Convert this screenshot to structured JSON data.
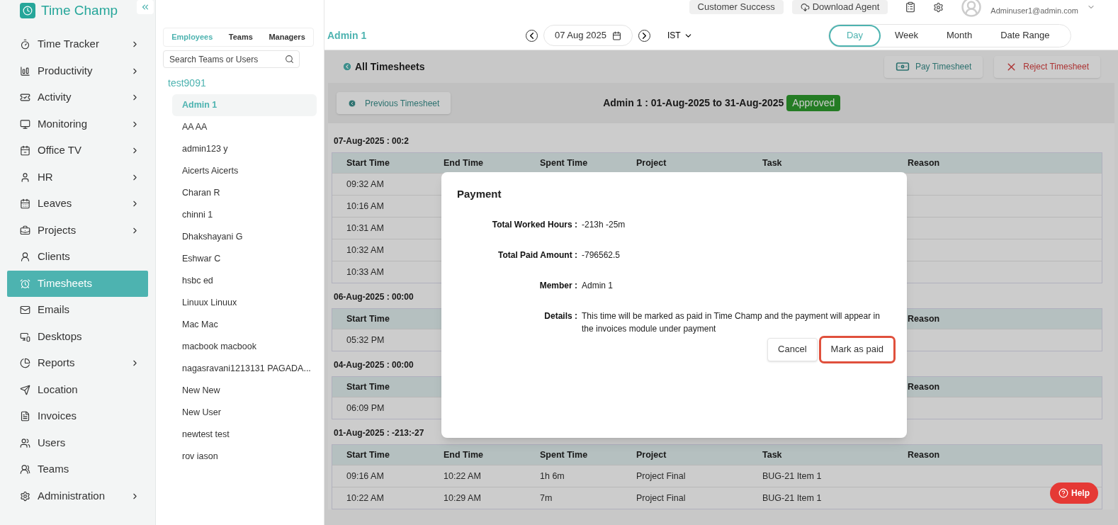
{
  "brand": {
    "name": "Time Champ"
  },
  "top_bar": {
    "buttons": [
      "Customer Success",
      "Download Agent"
    ],
    "user_email": "Adminuser1@admin.com"
  },
  "sidebar": {
    "items": [
      {
        "label": "Time Tracker",
        "selected": false,
        "has_submenu": true
      },
      {
        "label": "Productivity",
        "selected": false,
        "has_submenu": true
      },
      {
        "label": "Activity",
        "selected": false,
        "has_submenu": true
      },
      {
        "label": "Monitoring",
        "selected": false,
        "has_submenu": true
      },
      {
        "label": "Office TV",
        "selected": false,
        "has_submenu": true
      },
      {
        "label": "HR",
        "selected": false,
        "has_submenu": true
      },
      {
        "label": "Leaves",
        "selected": false,
        "has_submenu": true
      },
      {
        "label": "Projects",
        "selected": false,
        "has_submenu": true
      },
      {
        "label": "Clients",
        "selected": false,
        "has_submenu": false
      },
      {
        "label": "Timesheets",
        "selected": true,
        "has_submenu": false
      },
      {
        "label": "Emails",
        "selected": false,
        "has_submenu": false
      },
      {
        "label": "Desktops",
        "selected": false,
        "has_submenu": false
      },
      {
        "label": "Reports",
        "selected": false,
        "has_submenu": true
      },
      {
        "label": "Location",
        "selected": false,
        "has_submenu": false
      },
      {
        "label": "Invoices",
        "selected": false,
        "has_submenu": false
      },
      {
        "label": "Users",
        "selected": false,
        "has_submenu": false
      },
      {
        "label": "Teams",
        "selected": false,
        "has_submenu": false
      },
      {
        "label": "Administration",
        "selected": false,
        "has_submenu": true
      }
    ]
  },
  "member_panel": {
    "tabs": [
      {
        "label": "Employees",
        "selected": true
      },
      {
        "label": "Teams",
        "selected": false
      },
      {
        "label": "Managers",
        "selected": false
      }
    ],
    "search": {
      "placeholder": "Search Teams or Users"
    },
    "group": "test9091",
    "members": [
      {
        "name": "Admin 1",
        "selected": true
      },
      {
        "name": "AA AA",
        "selected": false
      },
      {
        "name": "admin123 y",
        "selected": false
      },
      {
        "name": "Aicerts Aicerts",
        "selected": false
      },
      {
        "name": "Charan R",
        "selected": false
      },
      {
        "name": "chinni 1",
        "selected": false
      },
      {
        "name": "Dhakshayani G",
        "selected": false
      },
      {
        "name": "Eshwar C",
        "selected": false
      },
      {
        "name": "hsbc ed",
        "selected": false
      },
      {
        "name": "Linuux Linuux",
        "selected": false
      },
      {
        "name": "Mac Mac",
        "selected": false
      },
      {
        "name": "macbook macbook",
        "selected": false
      },
      {
        "name": "nagasravani1213131 PAGADA...",
        "selected": false
      },
      {
        "name": "New New",
        "selected": false
      },
      {
        "name": "New User",
        "selected": false
      },
      {
        "name": "newtest test",
        "selected": false
      },
      {
        "name": "rov iason",
        "selected": false
      }
    ]
  },
  "filter_bar": {
    "member": "Admin 1",
    "date": "07 Aug 2025",
    "timezone": "IST",
    "ranges": [
      {
        "label": "Day",
        "selected": true
      },
      {
        "label": "Week",
        "selected": false
      },
      {
        "label": "Month",
        "selected": false
      },
      {
        "label": "Date Range",
        "selected": false
      }
    ]
  },
  "timesheet": {
    "back_label": "All Timesheets",
    "actions": [
      {
        "label": "Pay Timesheet",
        "kind": "pay"
      },
      {
        "label": "Reject Timesheet",
        "kind": "reject"
      }
    ],
    "previous_button": "Previous Timesheet",
    "title": "Admin 1 : 01-Aug-2025 to 31-Aug-2025",
    "status": "Approved",
    "days": [
      {
        "heading": "07-Aug-2025 : 00:2",
        "columns": {
          "start_time": "Start Time",
          "end_time": "End Time",
          "spent_time": "Spent Time",
          "project": "Project",
          "task": "Task",
          "reason": "Reason"
        },
        "rows": [
          {
            "start_time": "09:32 AM"
          },
          {
            "start_time": "10:16 AM"
          },
          {
            "start_time": "10:31 AM"
          },
          {
            "start_time": "10:32 AM"
          },
          {
            "start_time": "10:33 AM"
          }
        ]
      },
      {
        "heading": "06-Aug-2025 : 00:00",
        "columns": {
          "start_time": "Start Time",
          "reason": "Reason"
        },
        "rows": [
          {
            "start_time": "05:32 PM"
          }
        ]
      },
      {
        "heading": "04-Aug-2025 : 00:00",
        "columns": {
          "start_time": "Start Time",
          "reason": "Reason"
        },
        "rows": [
          {
            "start_time": "06:09 PM"
          }
        ]
      },
      {
        "heading": "01-Aug-2025 : -213:-27",
        "columns": {
          "start_time": "Start Time",
          "end_time": "End Time",
          "spent_time": "Spent Time",
          "project": "Project",
          "task": "Task",
          "reason": "Reason"
        },
        "rows": [
          {
            "start_time": "09:16 AM",
            "end_time": "10:22 AM",
            "spent_time": "1h 6m",
            "project": "Project Final",
            "task": "BUG-21 Item 1"
          },
          {
            "start_time": "10:22 AM",
            "end_time": "10:29 AM",
            "spent_time": "7m",
            "project": "Project Final",
            "task": "BUG-21 Item 1"
          }
        ]
      }
    ]
  },
  "payment_dialog": {
    "title": "Payment",
    "fields": [
      {
        "label": "Total Worked Hours :",
        "value": "-213h -25m"
      },
      {
        "label": "Total Paid Amount :",
        "value": "-796562.5"
      },
      {
        "label": "Member :",
        "value": "Admin 1"
      },
      {
        "label": "Details :",
        "value": "This time will be marked as paid in Time Champ and the payment will appear in the invoices module under payment"
      }
    ],
    "buttons": [
      {
        "label": "Cancel",
        "highlighted": false
      },
      {
        "label": "Mark as paid",
        "highlighted": true
      }
    ]
  },
  "help_button": "Help"
}
